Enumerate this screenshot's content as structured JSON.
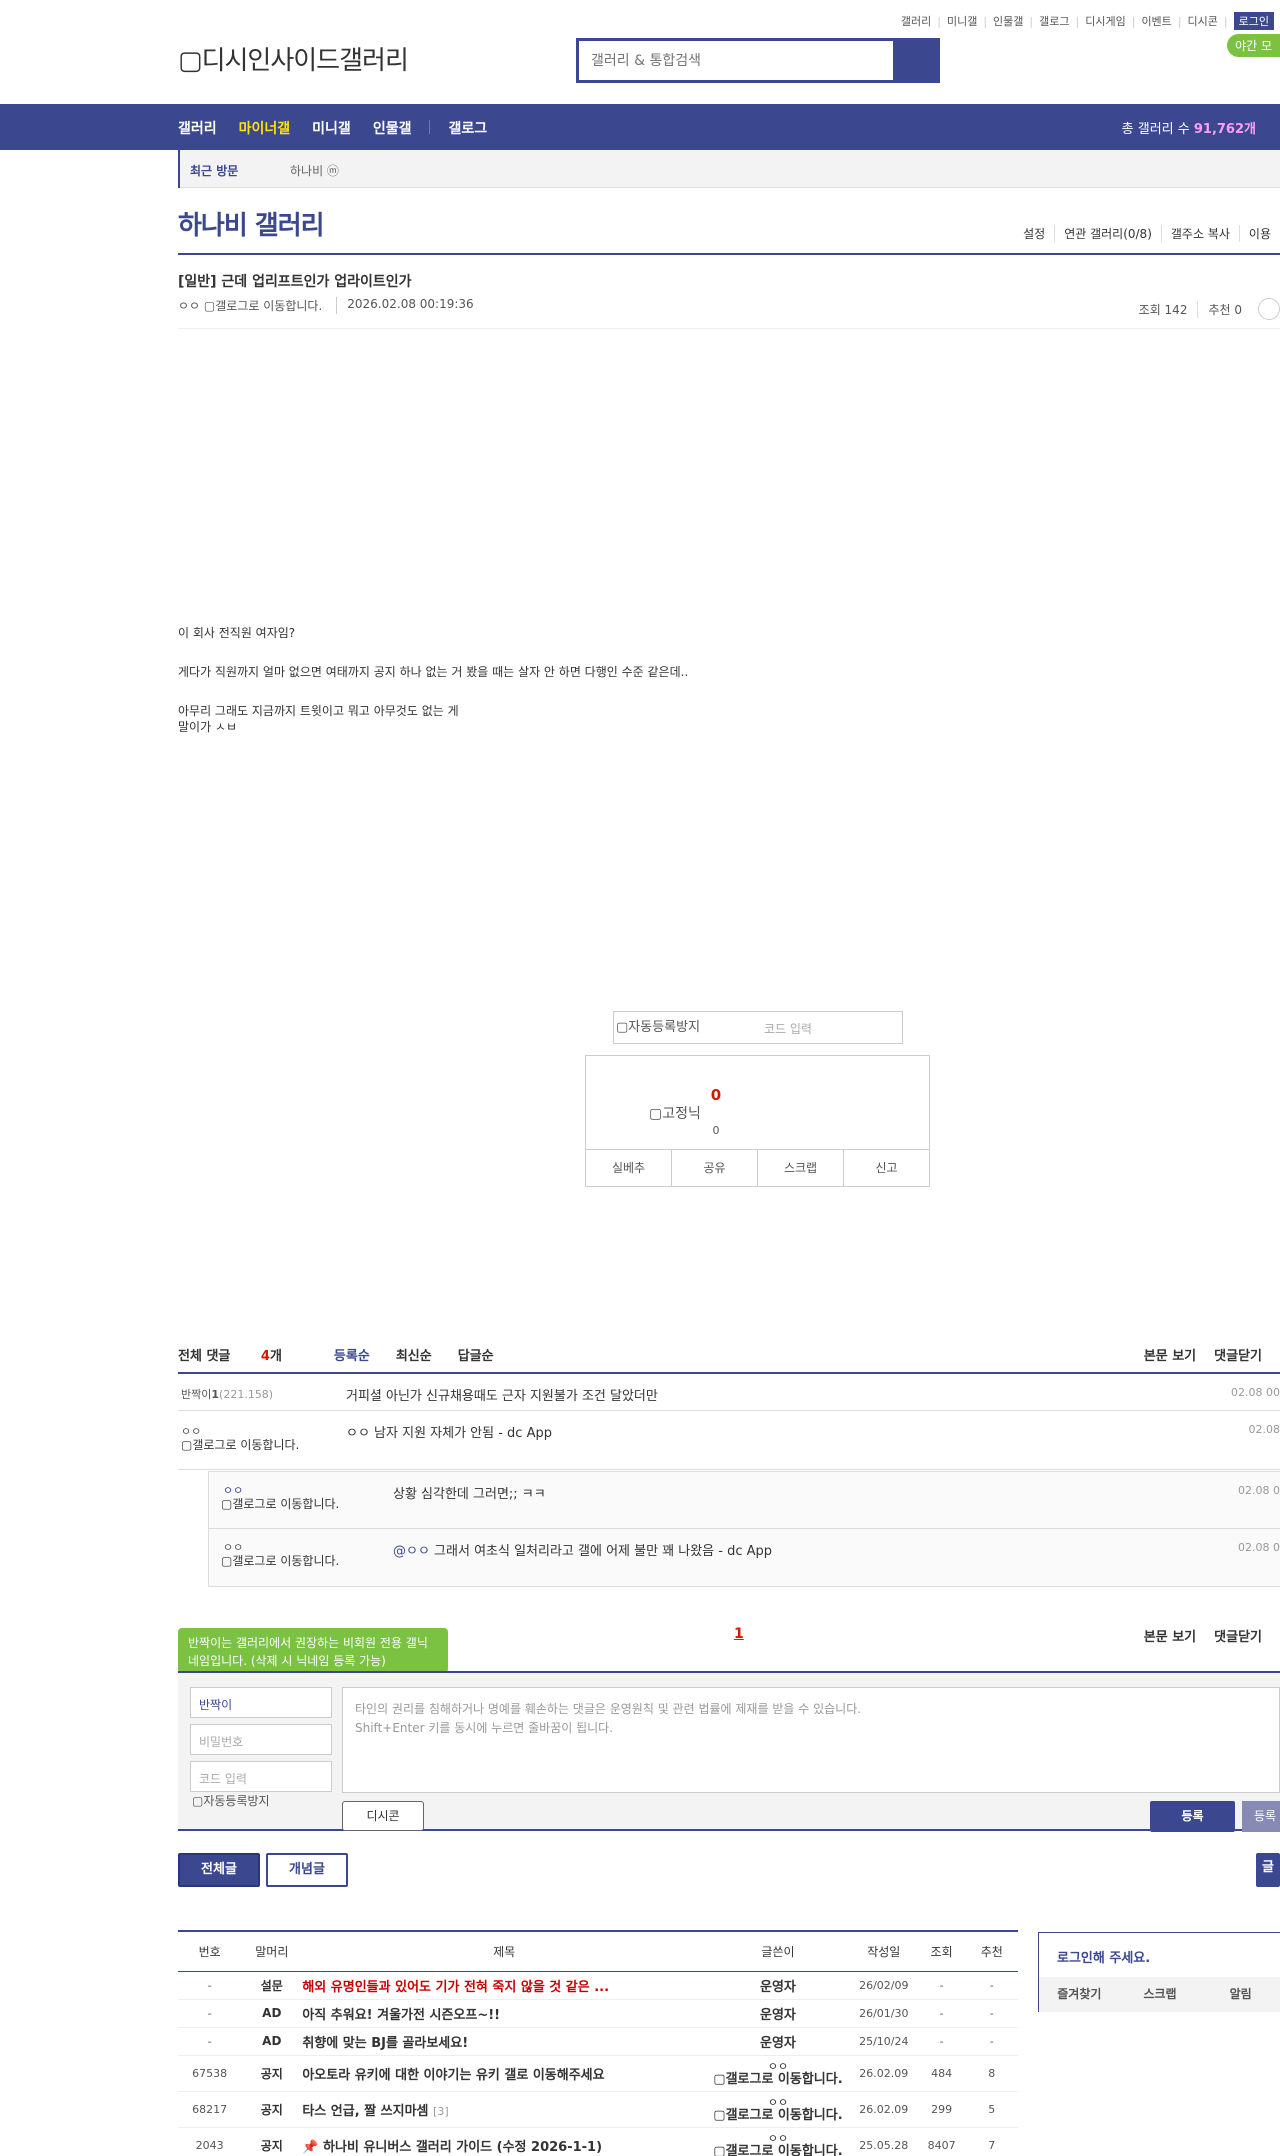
{
  "util_links": [
    "갤러리",
    "미니갤",
    "인물갤",
    "갤로그",
    "디시게임",
    "이벤트",
    "디시콘"
  ],
  "login": "로그인",
  "logo_alt": "디시인사이드갤러리",
  "search_placeholder": "갤러리 & 통합검색",
  "night_mode": "야간 모",
  "gnb": {
    "items": [
      "갤러리",
      "마이너갤",
      "미니갤",
      "인물갤",
      "갤로그"
    ],
    "total_label": "총 갤러리 수",
    "total_value": "91,762개"
  },
  "recent": {
    "title": "최근 방문",
    "item": "하나비 ⓜ"
  },
  "gallery": {
    "title": "하나비 갤러리",
    "menu": [
      "설정",
      "연관 갤러리(0/8)",
      "갤주소 복사",
      "이용"
    ]
  },
  "post": {
    "title": "[일반] 근데 업리프트인가 업라이트인가",
    "author": "ㅇㅇ",
    "author_img": "갤로그로 이동합니다.",
    "date": "2026.02.08 00:19:36",
    "views": "조회 142",
    "recommend": "추천 0",
    "body": [
      "이 회사 전직원 여자임?",
      "게다가 직원까지 얼마 없으면 여태까지 공지 하나 없는 거 봤을 때는 살자 안 하면 다행인 수준 같은데..",
      "아무리 그래도 지금까지 트윗이고 뭐고 아무것도 없는 게",
      "말이가 ㅅㅂ"
    ]
  },
  "captcha": {
    "img": "자동등록방지",
    "placeholder": "코드 입력"
  },
  "recommend_box": {
    "count": "0",
    "img": "고정닉",
    "sub": "0",
    "buttons": [
      "실베추",
      "공유",
      "스크랩",
      "신고"
    ]
  },
  "comments": {
    "total_label": "전체 댓글",
    "total_count": "4",
    "total_unit": "개",
    "sorts": [
      "등록순",
      "최신순",
      "답글순"
    ],
    "right": [
      "본문 보기",
      "댓글닫기"
    ],
    "rows": [
      {
        "nick": "반짝이",
        "nick_num": "1",
        "ip": "(221.158)",
        "text": "거피셜 아닌가 신규채용때도 근자 지원불가 조건 달았더만",
        "date": "02.08 00"
      },
      {
        "nick": "ㅇㅇ",
        "img": "갤로그로 이동합니다.",
        "text": "ㅇㅇ 남자 지원 자체가 안됨 - dc App",
        "date": "02.08"
      },
      {
        "nick": "ㅇㅇ",
        "img": "갤로그로 이동합니다.",
        "text": "상황 심각한데 그러면;; ㅋㅋ",
        "date": "02.08 0"
      },
      {
        "nick": "ㅇㅇ",
        "img": "갤로그로 이동합니다.",
        "mention": "@ㅇㅇ",
        "text": " 그래서 여초식 일처리라고 갤에 어제 불만 꽤 나왔음 - dc App",
        "date": "02.08 0"
      }
    ],
    "page": "1"
  },
  "write": {
    "tooltip": "반짝이는 갤러리에서 권장하는 비회원 전용 갤닉네임입니다. (삭제 시 닉네임 등록 가능)",
    "nick": "반짝이",
    "pw": "비밀번호",
    "code": "코드 입력",
    "captcha": "자동등록방지",
    "placeholder1": "타인의 권리를 침해하거나 명예를 훼손하는 댓글은 운영원칙 및 관련 법률에 제재를 받을 수 있습니다.",
    "placeholder2": "Shift+Enter 키를 동시에 누르면 줄바꿈이 됩니다.",
    "dccon": "디시콘",
    "register": "등록",
    "register2": "등록"
  },
  "tabs": {
    "all": "전체글",
    "concept": "개념글",
    "right": "글"
  },
  "list": {
    "headers": [
      "번호",
      "말머리",
      "제목",
      "글쓴이",
      "작성일",
      "조회",
      "추천"
    ],
    "rows": [
      {
        "no": "-",
        "head": "설문",
        "title": "해외 유명인들과 있어도 기가 전혀 죽지 않을 것 같은 ...",
        "red": true,
        "writer": "운영자",
        "date": "26/02/09",
        "view": "-",
        "rec": "-"
      },
      {
        "no": "-",
        "head": "AD",
        "title": "아직 추워요! 겨울가전 시즌오프~!!",
        "writer": "운영자",
        "date": "26/01/30",
        "view": "-",
        "rec": "-"
      },
      {
        "no": "-",
        "head": "AD",
        "title": "취향에 맞는 BJ를 골라보세요!",
        "writer": "운영자",
        "date": "25/10/24",
        "view": "-",
        "rec": "-"
      },
      {
        "no": "67538",
        "head": "공지",
        "title": "아오토라 유키에 대한 이야기는 유키 갤로 이동해주세요",
        "writer_top": "ㅇㅇ",
        "writer": "갤로그로 이동합니다.",
        "date": "26.02.09",
        "view": "484",
        "rec": "8"
      },
      {
        "no": "68217",
        "head": "공지",
        "title": "타스 언급, 짤 쓰지마셈",
        "count": "[3]",
        "writer_top": "ㅇㅇ",
        "writer": "갤로그로 이동합니다.",
        "date": "26.02.09",
        "view": "299",
        "rec": "5"
      },
      {
        "no": "2043",
        "head": "공지",
        "title": "📌 하나비 유니버스 갤러리 가이드 (수정 2026-1-1)",
        "writer_top": "ㅇㅇ",
        "writer": "갤로그로 이동합니다.",
        "date": "25.05.28",
        "view": "8407",
        "rec": "7"
      }
    ]
  },
  "loginbox": {
    "title": "로그인해 주세요.",
    "buttons": [
      "즐겨찾기",
      "스크랩",
      "알림"
    ]
  },
  "colors": {
    "brand": "#3b4890",
    "accent_green": "#7bc142",
    "alert_red": "#d31900"
  }
}
